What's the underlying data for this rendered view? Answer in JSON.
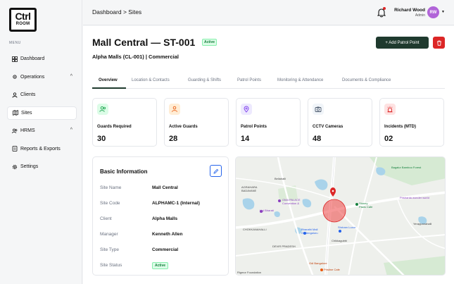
{
  "logo": {
    "line1": "Ctrl",
    "line2": "ROOM"
  },
  "sidebar": {
    "menu_label": "MENU",
    "items": [
      {
        "label": "Dashboard",
        "icon": "grid-icon"
      },
      {
        "label": "Operations",
        "icon": "settings-sliders-icon",
        "chevron": "^"
      },
      {
        "label": "Clients",
        "icon": "user-icon"
      },
      {
        "label": "Sites",
        "icon": "map-icon"
      },
      {
        "label": "HRMS",
        "icon": "users-icon",
        "chevron": "^"
      },
      {
        "label": "Reports & Exports",
        "icon": "document-icon"
      },
      {
        "label": "Settings",
        "icon": "gear-icon"
      }
    ]
  },
  "header": {
    "breadcrumb": "Dashboard  >  Sites",
    "user_name": "Richard Wood",
    "user_role": "Admin",
    "avatar_initials": "RW"
  },
  "site": {
    "title": "Mall Central — ST-001",
    "status": "Active",
    "subtitle": "Alpha Malls (CL-001) | Commercial",
    "add_button": "+  Add Patrol Point"
  },
  "tabs": [
    "Overview",
    "Location & Contacts",
    "Guarding & Shifts",
    "Patrol Points",
    "Monitoring & Attendance",
    "Documents & Compliance"
  ],
  "stats": [
    {
      "label": "Guards Required",
      "value": "30",
      "color": "#16a34a",
      "bg": "#dcfce7"
    },
    {
      "label": "Active Guards",
      "value": "28",
      "color": "#ea580c",
      "bg": "#ffedd5"
    },
    {
      "label": "Patrol Points",
      "value": "14",
      "color": "#7c3aed",
      "bg": "#ede9fe"
    },
    {
      "label": "CCTV Cameras",
      "value": "48",
      "color": "#475569",
      "bg": "#f1f5f9"
    },
    {
      "label": "Incidents (MTD)",
      "value": "02",
      "color": "#dc2626",
      "bg": "#fee2e2"
    }
  ],
  "basic_info": {
    "title": "Basic Information",
    "rows": [
      {
        "key": "Site Name",
        "value": "Mall Central"
      },
      {
        "key": "Site Code",
        "value": "ALPHAMC-1 (Internal)"
      },
      {
        "key": "Client",
        "value": "Alpha Malls"
      },
      {
        "key": "Manager",
        "value": "Kenneth Allen"
      },
      {
        "key": "Site Type",
        "value": "Commercial"
      },
      {
        "key": "Site Status",
        "value": "Active"
      }
    ]
  },
  "map": {
    "labels": [
      "Bellahalli",
      "AGRAHARA",
      "BADAVANE",
      "OMA PALACE",
      "Convention &",
      "Bagalur Bamboo Forest",
      "Yerappanahalli",
      "Chikkagubbi",
      "Bharathi Mall",
      "Of Bengaluru",
      "Shriram Luxor",
      "Stoney",
      "Paws Cafe",
      "Prishanta wonder world",
      "Hgi Bharati",
      "CHOKKANAHALLI",
      "DEVIR PRADESH",
      "Odi Bangalore",
      "Pristine Cafe",
      "Rigmor Foundation"
    ]
  }
}
